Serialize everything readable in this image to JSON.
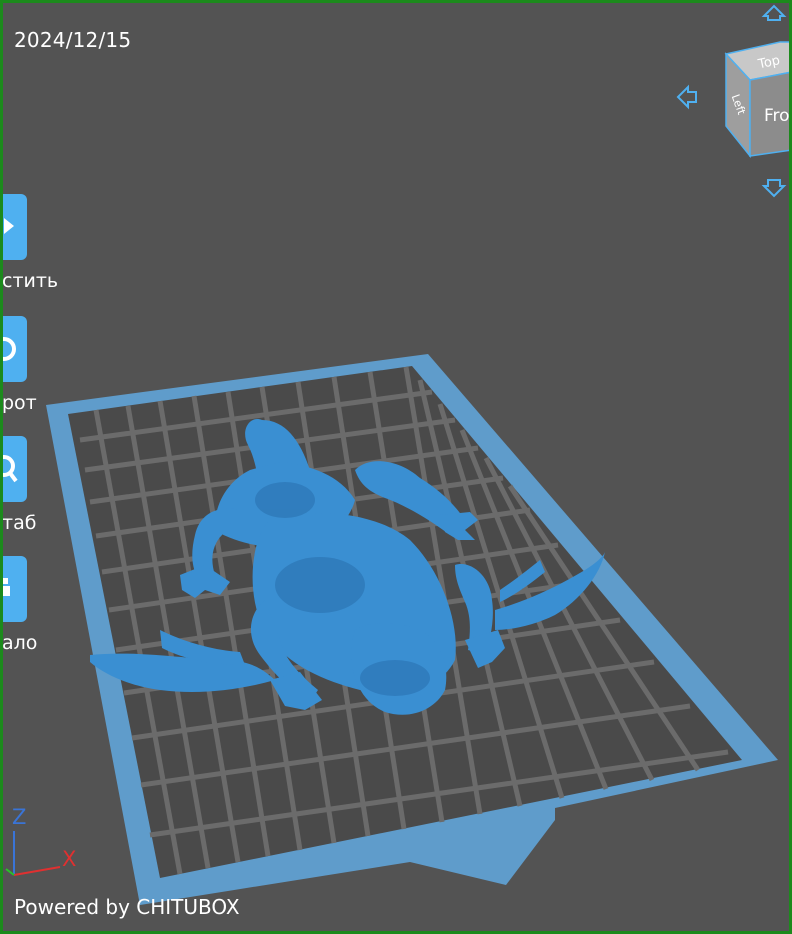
{
  "viewport": {
    "date": "2024/12/15",
    "powered_by": "Powered by CHITUBOX"
  },
  "toolbar": {
    "items": [
      {
        "label": "стить",
        "icon": "move-icon"
      },
      {
        "label": "рот",
        "icon": "rotate-icon"
      },
      {
        "label": "таб",
        "icon": "scale-icon"
      },
      {
        "label": "ало",
        "icon": "mirror-icon"
      }
    ]
  },
  "view_cube": {
    "top": "Top",
    "left": "Left",
    "front": "Front"
  },
  "axes": {
    "x": "X",
    "z": "Z"
  },
  "colors": {
    "background": "#535353",
    "accent": "#4fb0f0",
    "model": "#3a8fd2",
    "plate_border": "#5f9ccb",
    "grid": "#6b6b6b"
  }
}
